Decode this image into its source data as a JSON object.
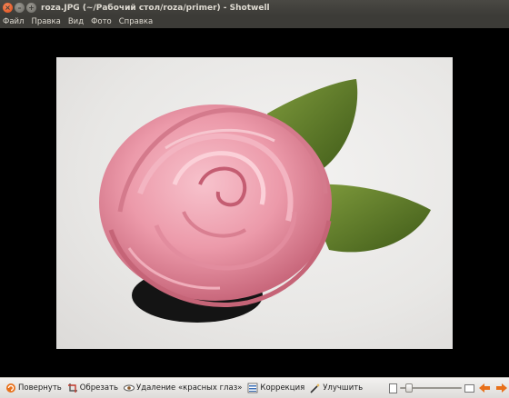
{
  "window": {
    "title": "roza.JPG (~/Рабочий стол/roza/primer) - Shotwell"
  },
  "menu": {
    "items": [
      {
        "label": "Файл"
      },
      {
        "label": "Правка"
      },
      {
        "label": "Вид"
      },
      {
        "label": "Фото"
      },
      {
        "label": "Справка"
      }
    ]
  },
  "toolbar": {
    "rotate_label": "Повернуть",
    "crop_label": "Обрезать",
    "redeye_label": "Удаление «красных глаз»",
    "adjust_label": "Коррекция",
    "enhance_label": "Улучшить",
    "zoom_level": 0.1
  },
  "colors": {
    "titlebar": "#3c3b37",
    "title_text": "#dfdbd2",
    "close_button": "#df4a16",
    "toolbar_bg": "#edecea",
    "nav_arrow": "#e8701a"
  }
}
